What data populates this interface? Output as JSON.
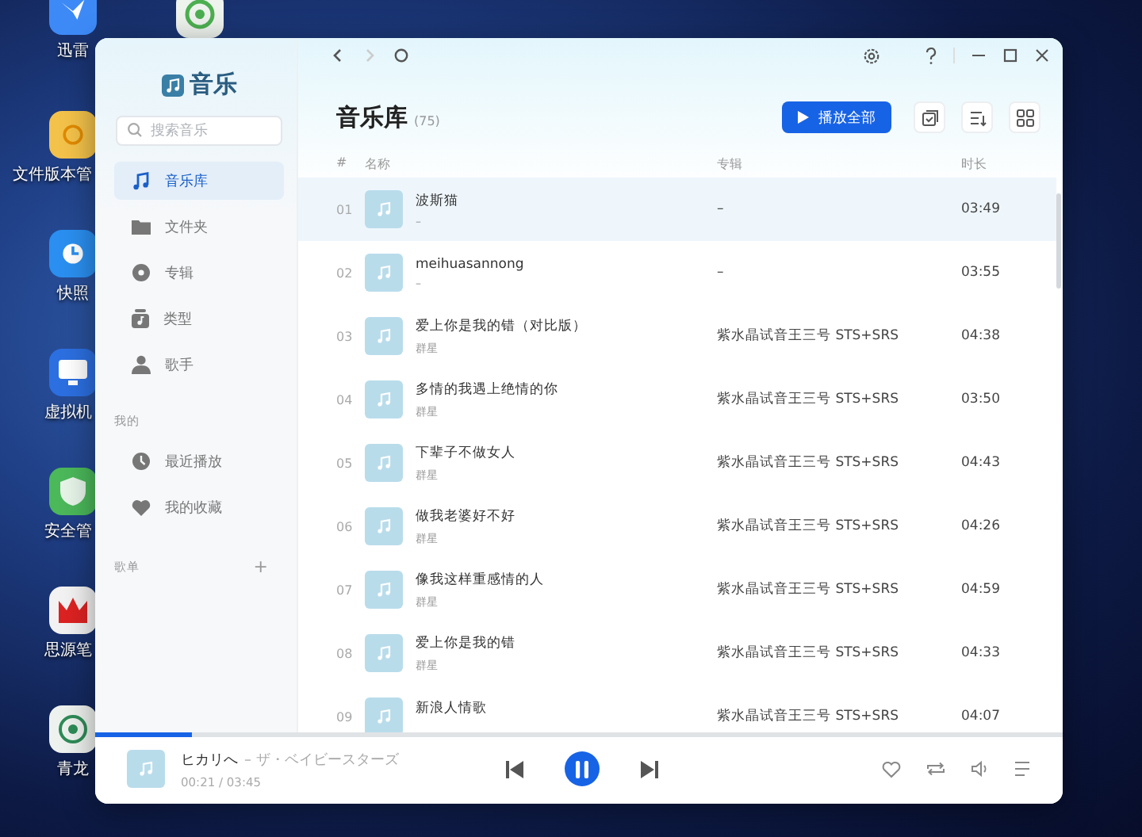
{
  "desktop_icons": [
    {
      "label": "迅雷"
    },
    {
      "label": "文件版本管"
    },
    {
      "label": "快照"
    },
    {
      "label": "虚拟机"
    },
    {
      "label": "安全管"
    },
    {
      "label": "思源笔"
    },
    {
      "label": "青龙"
    }
  ],
  "app": {
    "name": "音乐",
    "search": {
      "placeholder": "搜索音乐"
    },
    "nav": [
      {
        "label": "音乐库",
        "selected": true
      },
      {
        "label": "文件夹",
        "selected": false
      },
      {
        "label": "专辑",
        "selected": false
      },
      {
        "label": "类型",
        "selected": false
      },
      {
        "label": "歌手",
        "selected": false
      }
    ],
    "my_section": {
      "title": "我的",
      "items": [
        {
          "label": "最近播放",
          "selected": false
        },
        {
          "label": "我的收藏",
          "selected": false
        }
      ]
    },
    "playlists": {
      "title": "歌单",
      "add": "+"
    },
    "forward_disabled": true
  },
  "library": {
    "title": "音乐库",
    "count": "(75)",
    "play_all": "播放全部",
    "columns": [
      "#",
      "名称",
      "专辑",
      "时长"
    ],
    "rows": [
      {
        "num": "01",
        "title": "波斯猫",
        "artist": "–",
        "album": "–",
        "duration": "03:49",
        "selected": true
      },
      {
        "num": "02",
        "title": "meihuasannong",
        "artist": "–",
        "album": "–",
        "duration": "03:55",
        "selected": false
      },
      {
        "num": "03",
        "title": "爱上你是我的错（对比版）",
        "artist": "群星",
        "album": "紫水晶试音王三号 STS+SRS",
        "duration": "04:38",
        "selected": false
      },
      {
        "num": "04",
        "title": "多情的我遇上绝情的你",
        "artist": "群星",
        "album": "紫水晶试音王三号 STS+SRS",
        "duration": "03:50",
        "selected": false
      },
      {
        "num": "05",
        "title": "下辈子不做女人",
        "artist": "群星",
        "album": "紫水晶试音王三号 STS+SRS",
        "duration": "04:43",
        "selected": false
      },
      {
        "num": "06",
        "title": "做我老婆好不好",
        "artist": "群星",
        "album": "紫水晶试音王三号 STS+SRS",
        "duration": "04:26",
        "selected": false
      },
      {
        "num": "07",
        "title": "像我这样重感情的人",
        "artist": "群星",
        "album": "紫水晶试音王三号 STS+SRS",
        "duration": "04:59",
        "selected": false
      },
      {
        "num": "08",
        "title": "爱上你是我的错",
        "artist": "群星",
        "album": "紫水晶试音王三号 STS+SRS",
        "duration": "04:33",
        "selected": false
      },
      {
        "num": "09",
        "title": "新浪人情歌",
        "album": "紫水晶试音王三号 STS+SRS",
        "duration": "04:07",
        "selected": false
      }
    ]
  },
  "player": {
    "title": "ヒカリへ",
    "artist": "– ザ・ベイビースターズ",
    "time": "00:21 / 03:45",
    "level": 0.1,
    "playing": true
  }
}
